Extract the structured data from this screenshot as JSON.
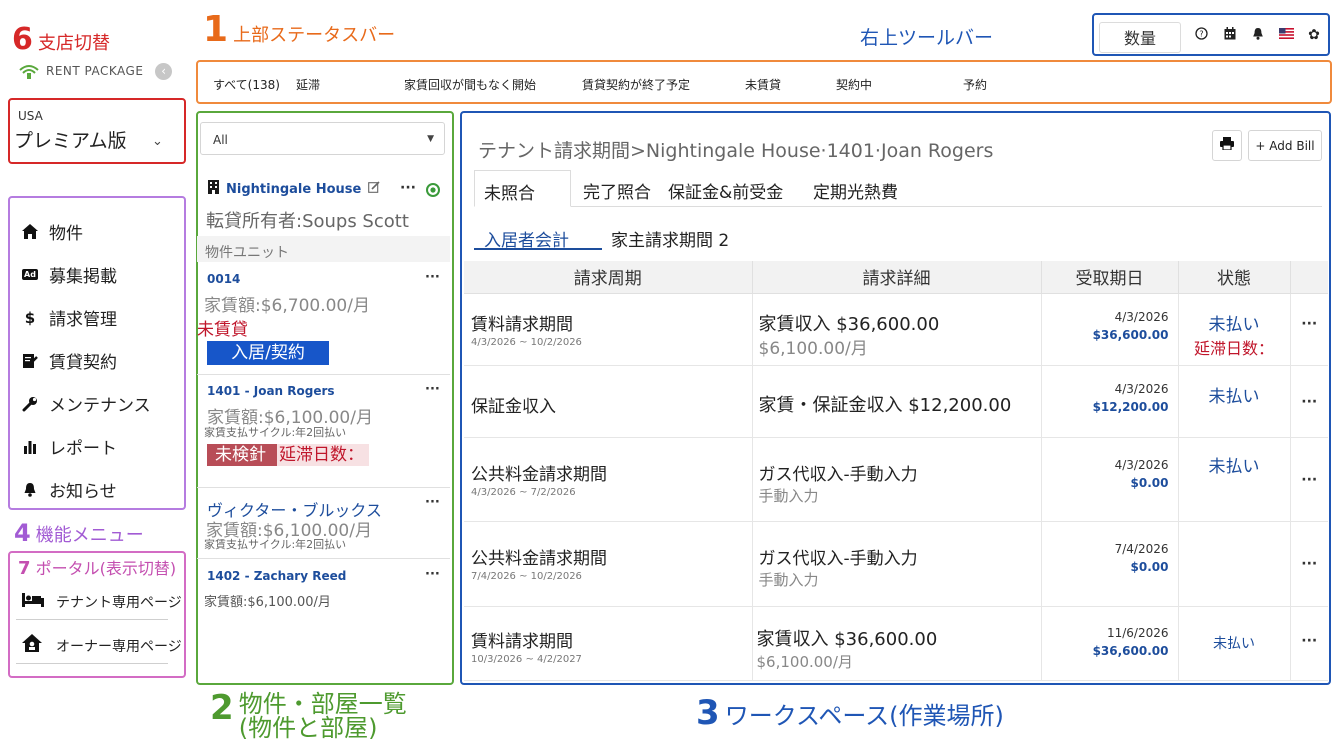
{
  "annotations": {
    "branch": {
      "num": "6",
      "label": "支店切替"
    },
    "status_bar": {
      "num": "1",
      "label": "上部ステータスバー"
    },
    "toolbar_label": "右上ツールバー",
    "property_list": {
      "num": "2",
      "label_line1": "物件・部屋一覧",
      "label_line2": "(物件と部屋)"
    },
    "workspace": {
      "num": "3",
      "label": "ワークスペース(作業場所)"
    },
    "function_menu": {
      "num": "4",
      "label": "機能メニュー"
    },
    "portal": {
      "num": "7",
      "label": "ポータル(表示切替)"
    }
  },
  "colors": {
    "red": "#d62828",
    "orange": "#e86a1a",
    "green": "#4e9a2f",
    "blue": "#1f56b5",
    "purple": "#a25bd4",
    "pink": "#c44fb0"
  },
  "logo": {
    "text": "RENT PACKAGE",
    "back_icon": "chevron-left-icon"
  },
  "branch": {
    "country": "USA",
    "name": "プレミアム版",
    "chevron_icon": "chevron-down-icon"
  },
  "menu": {
    "items": [
      {
        "label": "物件",
        "icon": "home-icon"
      },
      {
        "label": "募集掲載",
        "icon": "ad-icon"
      },
      {
        "label": "請求管理",
        "icon": "dollar-icon"
      },
      {
        "label": "賃貸契約",
        "icon": "contract-icon"
      },
      {
        "label": "メンテナンス",
        "icon": "wrench-icon"
      },
      {
        "label": "レポート",
        "icon": "chart-icon"
      },
      {
        "label": "お知らせ",
        "icon": "bell-icon"
      }
    ]
  },
  "portal": {
    "items": [
      {
        "label": "テナント専用ページ",
        "icon": "bed-icon"
      },
      {
        "label": "オーナー専用ページ",
        "icon": "owner-home-icon"
      }
    ]
  },
  "status_bar": {
    "items": [
      "すべて(138)",
      "延滞",
      "家賃回収が間もなく開始",
      "賃貸契約が終了予定",
      "未賃貸",
      "契約中",
      "予約"
    ]
  },
  "toolbar": {
    "quantity": "数量",
    "icons": [
      "help-icon",
      "calendar-icon",
      "bell-icon",
      "us-flag-icon",
      "gear-icon"
    ]
  },
  "property_panel": {
    "filter": "All",
    "property_name": "Nightingale House",
    "sublessee": "転貸所有者:Soups Scott",
    "units_header": "物件ユニット",
    "units": [
      {
        "name": "0014",
        "rent": "家賃額:$6,700.00/月",
        "status": "未賃貸",
        "action": "入居/契約"
      },
      {
        "name": "1401 - Joan Rogers",
        "rent": "家賃額:$6,100.00/月",
        "cycle": "家賃支払サイクル:年2回払い",
        "badge": "未検針",
        "late": "延滞日数："
      },
      {
        "name": "ヴィクター・ブルックス",
        "rent": "家賃額:$6,100.00/月",
        "cycle": "家賃支払サイクル:年2回払い"
      },
      {
        "name": "1402 - Zachary Reed",
        "rent": "家賃額:$6,100.00/月"
      }
    ]
  },
  "workspace": {
    "title": "テナント請求期間>Nightingale House·1401·Joan Rogers",
    "add_bill": "+ Add Bill",
    "tabs": [
      "未照合",
      "完了照合",
      "保証金&前受金",
      "定期光熱費"
    ],
    "subtabs": [
      "入居者会計",
      "家主請求期間 2"
    ],
    "columns": [
      "請求周期",
      "請求詳細",
      "受取期日",
      "状態"
    ],
    "rows": [
      {
        "cycle": "賃料請求期間",
        "range": "4/3/2026 ~ 10/2/2026",
        "detail": "家賃収入 $36,600.00",
        "detail_sub": "$6,100.00/月",
        "date": "4/3/2026",
        "amount": "$36,600.00",
        "status": "未払い",
        "late": "延滞日数："
      },
      {
        "cycle": "保証金収入",
        "range": "",
        "detail": "家賃・保証金収入 $12,200.00",
        "detail_sub": "",
        "date": "4/3/2026",
        "amount": "$12,200.00",
        "status": "未払い",
        "late": ""
      },
      {
        "cycle": "公共料金請求期間",
        "range": "4/3/2026 ~ 7/2/2026",
        "detail": "ガス代収入-手動入力",
        "detail_sub": "手動入力",
        "date": "4/3/2026",
        "amount": "$0.00",
        "status": "未払い",
        "late": ""
      },
      {
        "cycle": "公共料金請求期間",
        "range": "7/4/2026 ~ 10/2/2026",
        "detail": "ガス代収入-手動入力",
        "detail_sub": "手動入力",
        "date": "7/4/2026",
        "amount": "$0.00",
        "status": "",
        "late": ""
      },
      {
        "cycle": "賃料請求期間",
        "range": "10/3/2026 ~ 4/2/2027",
        "detail": "家賃収入 $36,600.00",
        "detail_sub": "$6,100.00/月",
        "date": "11/6/2026",
        "amount": "$36,600.00",
        "status": "未払い",
        "late": ""
      }
    ]
  }
}
